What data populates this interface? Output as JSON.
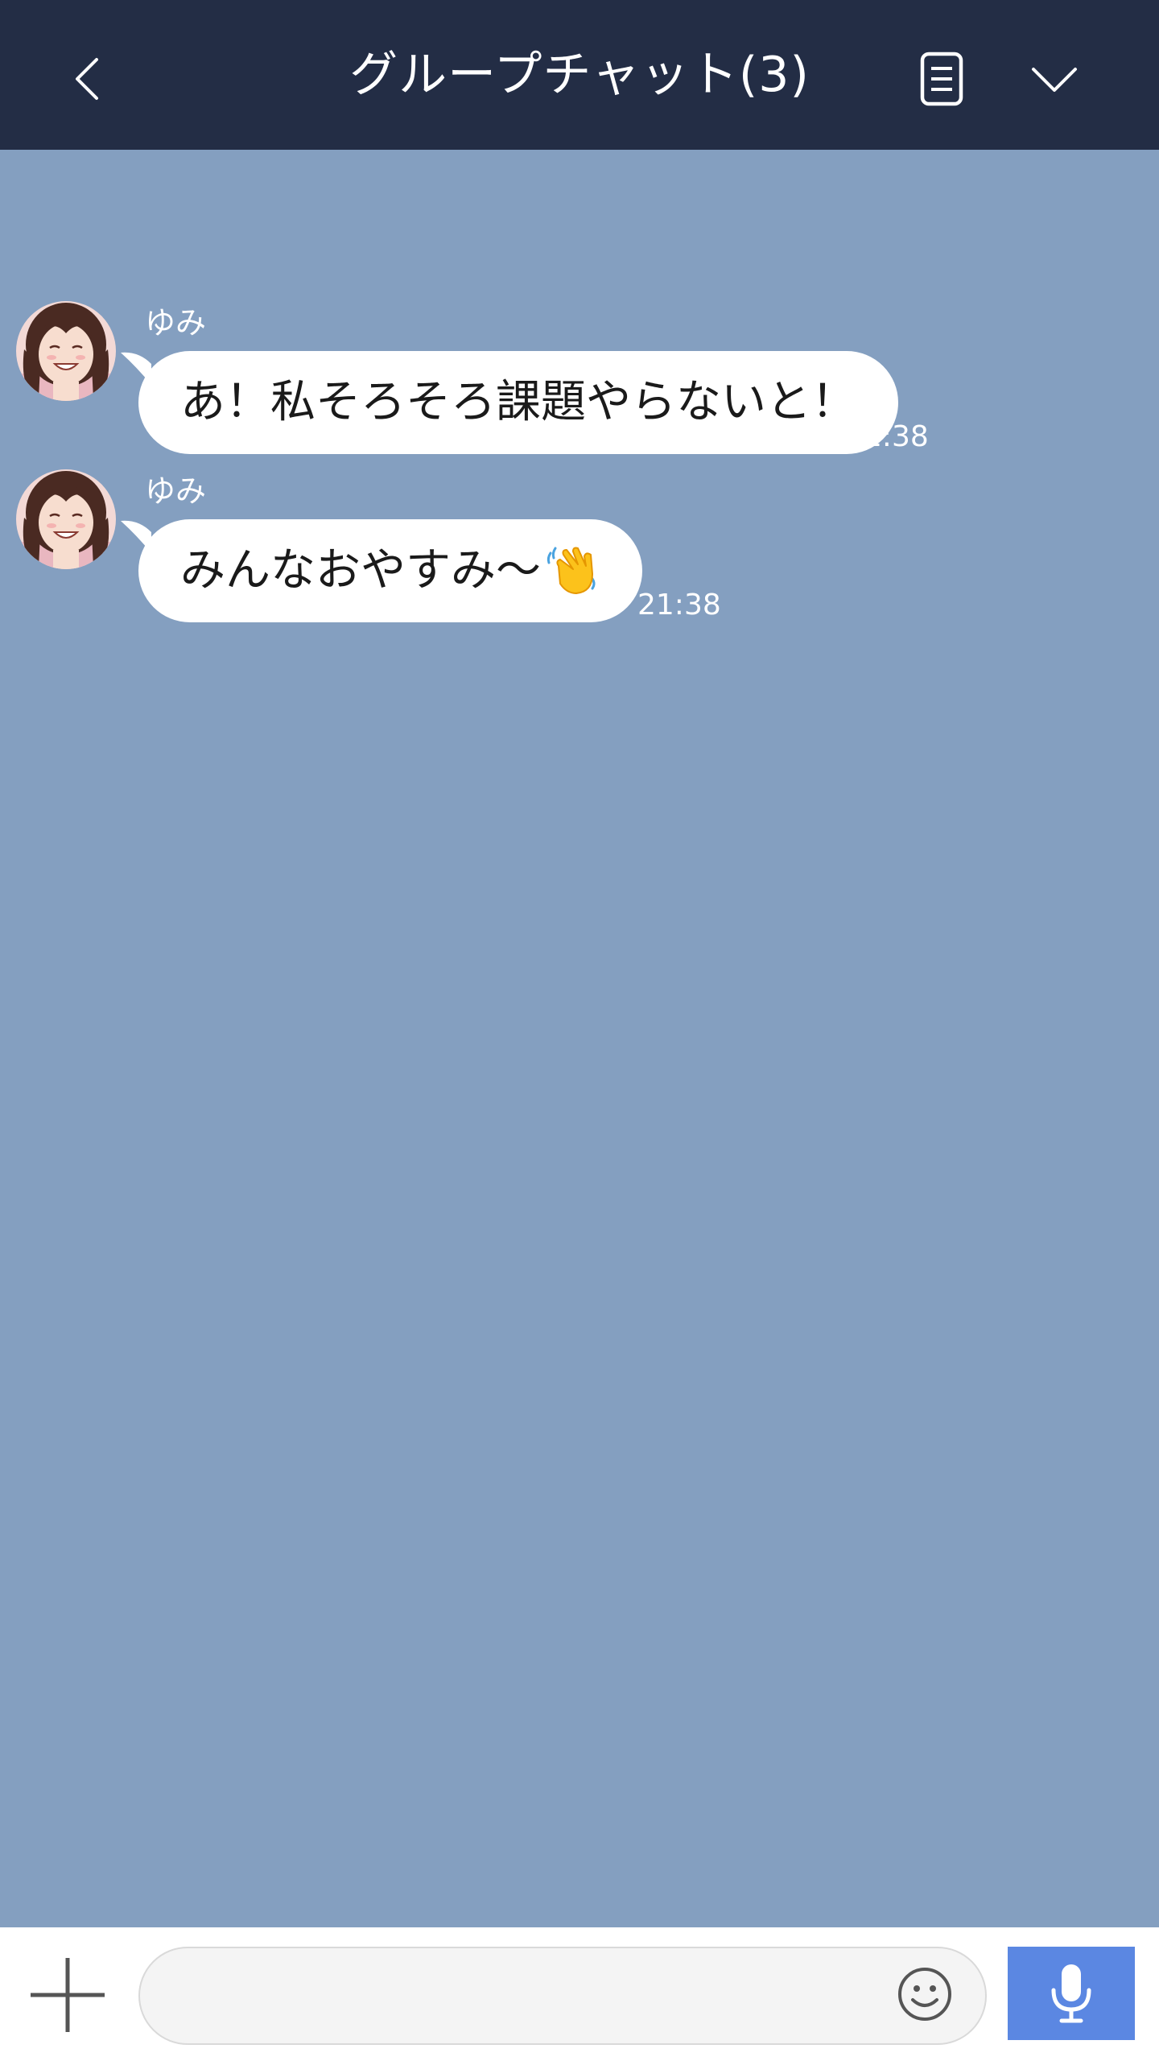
{
  "header": {
    "title": "グループチャット(3)",
    "back_icon": "chevron-left-icon",
    "note_icon": "note-icon",
    "menu_icon": "chevron-down-icon",
    "background": "#232d45"
  },
  "chat": {
    "background": "#849fc0",
    "messages": [
      {
        "sender": "ゆみ",
        "text": "あ！私そろそろ課題やらないと！",
        "time": "21:38"
      },
      {
        "sender": "ゆみ",
        "text": "みんなおやすみ～",
        "emoji": "waving-hand-icon",
        "time": "21:38"
      }
    ]
  },
  "input_bar": {
    "plus_icon": "plus-icon",
    "message_placeholder": "",
    "emoji_icon": "smiley-icon",
    "mic_icon": "microphone-icon",
    "mic_button_color": "#5b87e2"
  }
}
